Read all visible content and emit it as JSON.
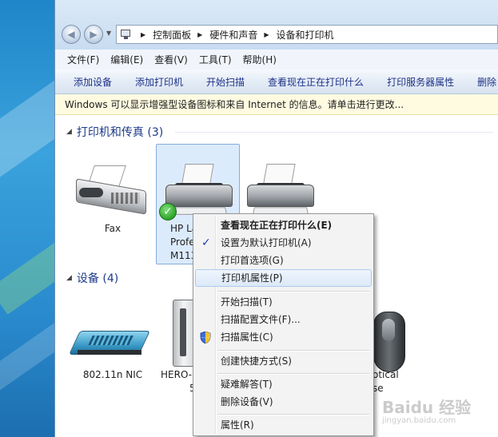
{
  "breadcrumb": [
    "控制面板",
    "硬件和声音",
    "设备和打印机"
  ],
  "menu": [
    "文件(F)",
    "编辑(E)",
    "查看(V)",
    "工具(T)",
    "帮助(H)"
  ],
  "commands": [
    "添加设备",
    "添加打印机",
    "开始扫描",
    "查看现在正在打印什么",
    "打印服务器属性",
    "删除"
  ],
  "infobar": "Windows 可以显示增强型设备图标和来自 Internet 的信息。请单击进行更改...",
  "printers_group": {
    "title": "打印机和传真 (3)",
    "devices": [
      {
        "label": "Fax",
        "icon": "fax-icon"
      },
      {
        "label_lines": [
          "HP La",
          "Profe",
          "M113"
        ],
        "icon": "printer-icon",
        "default": true
      },
      {
        "label": "",
        "icon": "printer-icon"
      }
    ]
  },
  "devices_group": {
    "title": "设备 (4)",
    "devices": [
      {
        "label": "802.11n NIC",
        "icon": "router-icon"
      },
      {
        "label_lines": [
          "HERO-",
          "5"
        ],
        "icon": "computer-tower-icon"
      },
      {
        "label_lines": [
          "otical",
          "se"
        ],
        "icon": "mouse-icon"
      }
    ]
  },
  "context_menu": {
    "items": [
      {
        "label": "查看现在正在打印什么(E)",
        "bold": true
      },
      {
        "label": "设置为默认打印机(A)",
        "checked": true
      },
      {
        "label": "打印首选项(G)"
      },
      {
        "label": "打印机属性(P)",
        "highlighted": true
      },
      {
        "label": "开始扫描(T)"
      },
      {
        "label": "扫描配置文件(F)..."
      },
      {
        "label": "扫描属性(C)",
        "icon": "uac-shield-icon"
      },
      {
        "label": "创建快捷方式(S)"
      },
      {
        "label": "疑难解答(T)"
      },
      {
        "label": "删除设备(V)"
      },
      {
        "label": "属性(R)"
      }
    ]
  },
  "watermark": {
    "text": "Baidu 经验",
    "sub": "jingyan.baidu.com"
  }
}
